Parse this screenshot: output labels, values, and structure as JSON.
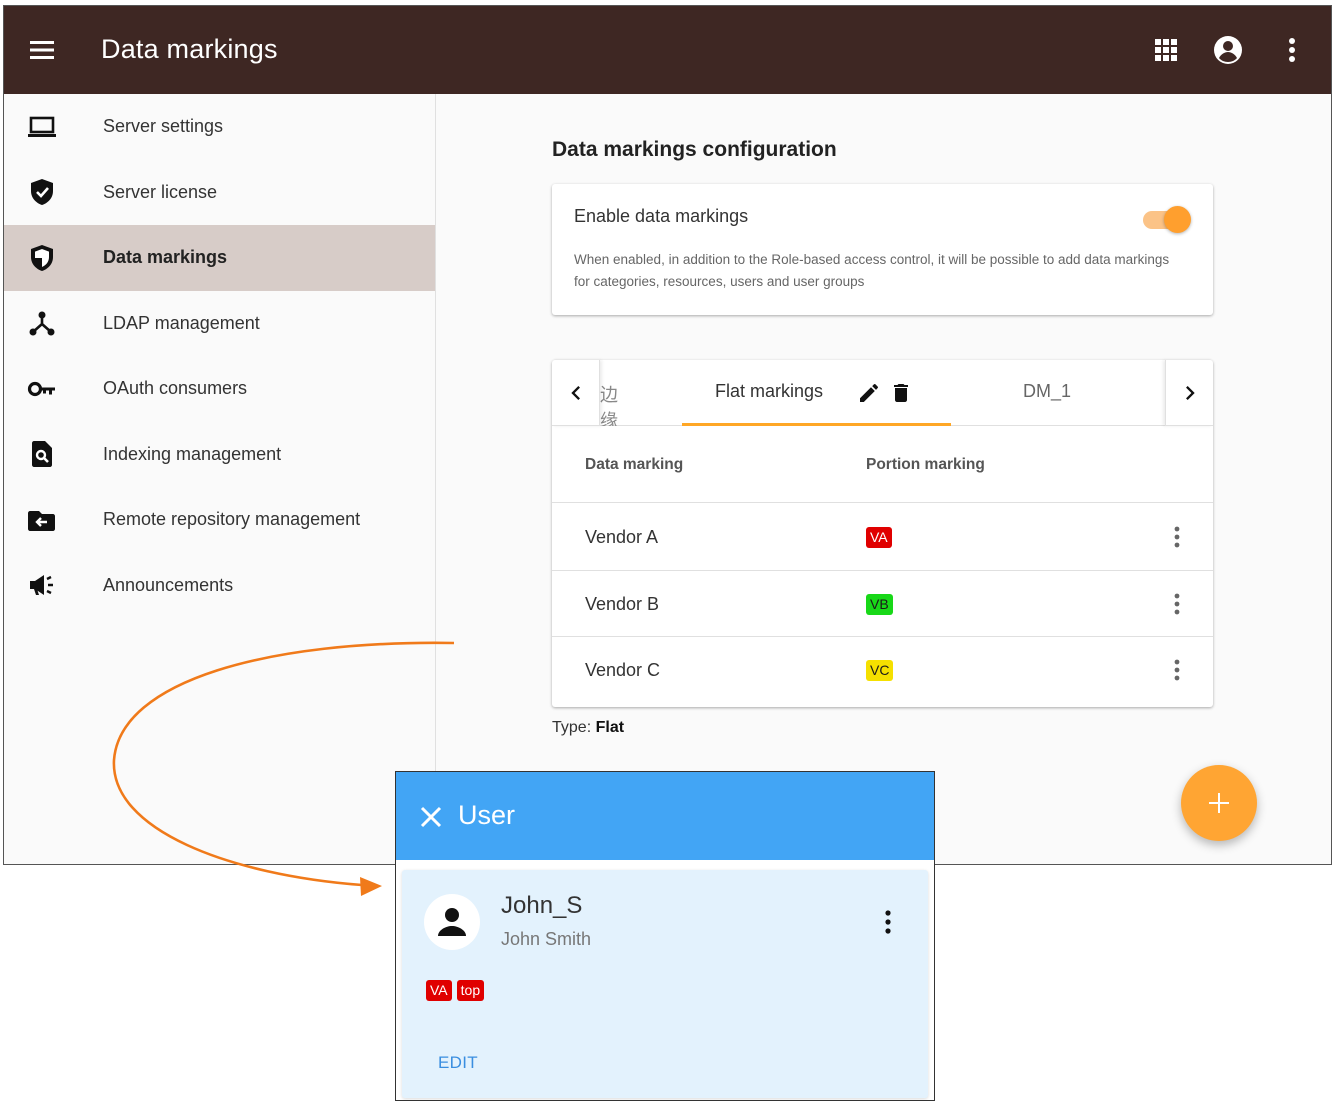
{
  "appbar": {
    "title": "Data markings",
    "icons": [
      "menu-icon",
      "apps-grid-icon",
      "account-circle-icon",
      "more-vert-icon"
    ]
  },
  "sidebar": {
    "items": [
      {
        "label": "Server settings",
        "icon": "laptop-icon",
        "active": false
      },
      {
        "label": "Server license",
        "icon": "verified-shield-icon",
        "active": false
      },
      {
        "label": "Data markings",
        "icon": "shield-half-icon",
        "active": true
      },
      {
        "label": "LDAP management",
        "icon": "hub-icon",
        "active": false
      },
      {
        "label": "OAuth consumers",
        "icon": "key-icon",
        "active": false
      },
      {
        "label": "Indexing management",
        "icon": "find-in-page-icon",
        "active": false
      },
      {
        "label": "Remote repository management",
        "icon": "folder-arrow-icon",
        "active": false
      },
      {
        "label": "Announcements",
        "icon": "megaphone-icon",
        "active": false
      }
    ]
  },
  "config": {
    "section_title": "Data markings configuration",
    "enable_title": "Enable data markings",
    "enable_desc": "When enabled, in addition to the Role-based access control, it will be possible to add data markings for categories, resources, users and user groups",
    "enabled": true
  },
  "tabs": {
    "partial_label": "边缘",
    "active_label": "Flat markings",
    "next_label": "DM_1"
  },
  "table": {
    "headers": [
      "Data marking",
      "Portion marking"
    ],
    "rows": [
      {
        "name": "Vendor A",
        "portion": "VA",
        "bg": "#e00000",
        "fg": "#ffffff"
      },
      {
        "name": "Vendor B",
        "portion": "VB",
        "bg": "#18d818",
        "fg": "#1a1a1a"
      },
      {
        "name": "Vendor C",
        "portion": "VC",
        "bg": "#f5e000",
        "fg": "#1a1a1a"
      }
    ]
  },
  "type_info": {
    "label": "Type:",
    "value": "Flat"
  },
  "user_panel": {
    "title": "User",
    "username": "John_S",
    "full_name": "John Smith",
    "badges": [
      "VA",
      "top"
    ],
    "edit_label": "EDIT"
  },
  "colors": {
    "appbar": "#3e2723",
    "accent": "#ffa726",
    "panel_header": "#42a5f5",
    "active_nav": "#d7ccc8",
    "arrow": "#f07a1a"
  }
}
